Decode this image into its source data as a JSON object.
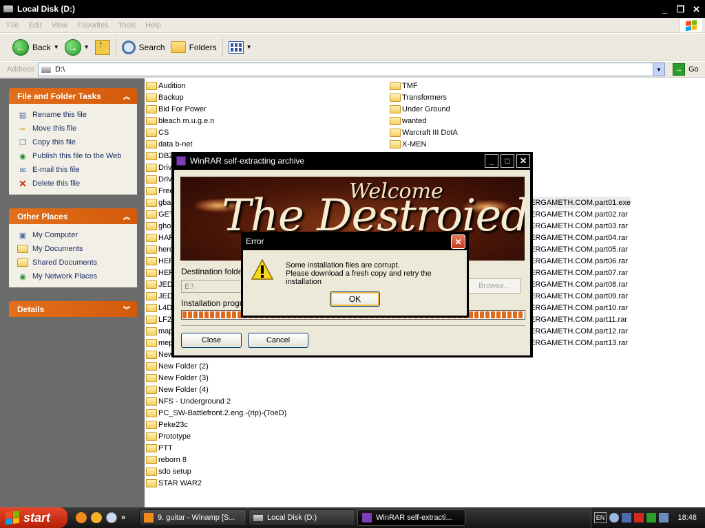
{
  "window": {
    "title": "Local Disk (D:)"
  },
  "menu": [
    "File",
    "Edit",
    "View",
    "Favorites",
    "Tools",
    "Help"
  ],
  "toolbar": {
    "back_label": "Back",
    "search_label": "Search",
    "folders_label": "Folders"
  },
  "address": {
    "label": "Address",
    "value": "D:\\",
    "go_label": "Go"
  },
  "tasks_panel": {
    "title": "File and Folder Tasks",
    "items": [
      "Rename this file",
      "Move this file",
      "Copy this file",
      "Publish this file to the Web",
      "E-mail this file",
      "Delete this file"
    ]
  },
  "places_panel": {
    "title": "Other Places",
    "items": [
      "My Computer",
      "My Documents",
      "Shared Documents",
      "My Network Places"
    ]
  },
  "details_panel": {
    "title": "Details"
  },
  "folders_col1": [
    "Audition",
    "Backup",
    "Bid For Power",
    "bleach m.u.g.e.n",
    "CS",
    "data b-net",
    "DBZ",
    "Drive",
    "Drive",
    "Free",
    "gba",
    "GET",
    "ghos",
    "HAR",
    "hero",
    "HER",
    "HER",
    "JEDI",
    "JEDI",
    "L4D",
    "LF2",
    "map",
    "mep",
    "New",
    "New Folder (2)",
    "New Folder (3)",
    "New Folder (4)",
    "NFS - Underground 2",
    "PC_SW-Battlefront.2.eng.-(rip)-(ToeD)",
    "Peke23c",
    "Prototype",
    "PTT",
    "reborn 8",
    "sdo setup",
    "STAR WAR2"
  ],
  "folders_col2": [
    "TMF",
    "Transformers",
    "Under Ground",
    "wanted",
    "Warcraft III DotA",
    "X-MEN"
  ],
  "rar_files": [
    "ERGAMETH.COM.part01.exe",
    "ERGAMETH.COM.part02.rar",
    "ERGAMETH.COM.part03.rar",
    "ERGAMETH.COM.part04.rar",
    "ERGAMETH.COM.part05.rar",
    "ERGAMETH.COM.part06.rar",
    "ERGAMETH.COM.part07.rar",
    "ERGAMETH.COM.part08.rar",
    "ERGAMETH.COM.part09.rar",
    "ERGAMETH.COM.part10.rar",
    "ERGAMETH.COM.part11.rar",
    "ERGAMETH.COM.part12.rar",
    "ERGAMETH.COM.part13.rar"
  ],
  "rar_dialog": {
    "title": "WinRAR self-extracting archive",
    "banner_welcome": "Welcome",
    "banner_title": "The Destroied",
    "destination_label": "Destination folder",
    "destination_value": "E:\\",
    "browse_label": "Browse...",
    "progress_label": "Installation progress",
    "progress_fraction": 1.0,
    "close_label": "Close",
    "cancel_label": "Cancel"
  },
  "error_dialog": {
    "title": "Error",
    "line1": "Some installation files are corrupt.",
    "line2": "Please download a fresh copy and retry the installation",
    "ok_label": "OK"
  },
  "taskbar": {
    "start_label": "start",
    "tasks": [
      "9. guitar - Winamp [S...",
      "Local Disk (D:)",
      "WinRAR self-extracti..."
    ],
    "lang": "EN",
    "clock": "18:48"
  },
  "colors": {
    "task_header": "#e0651a",
    "xp_blue": "#1b2c66"
  }
}
